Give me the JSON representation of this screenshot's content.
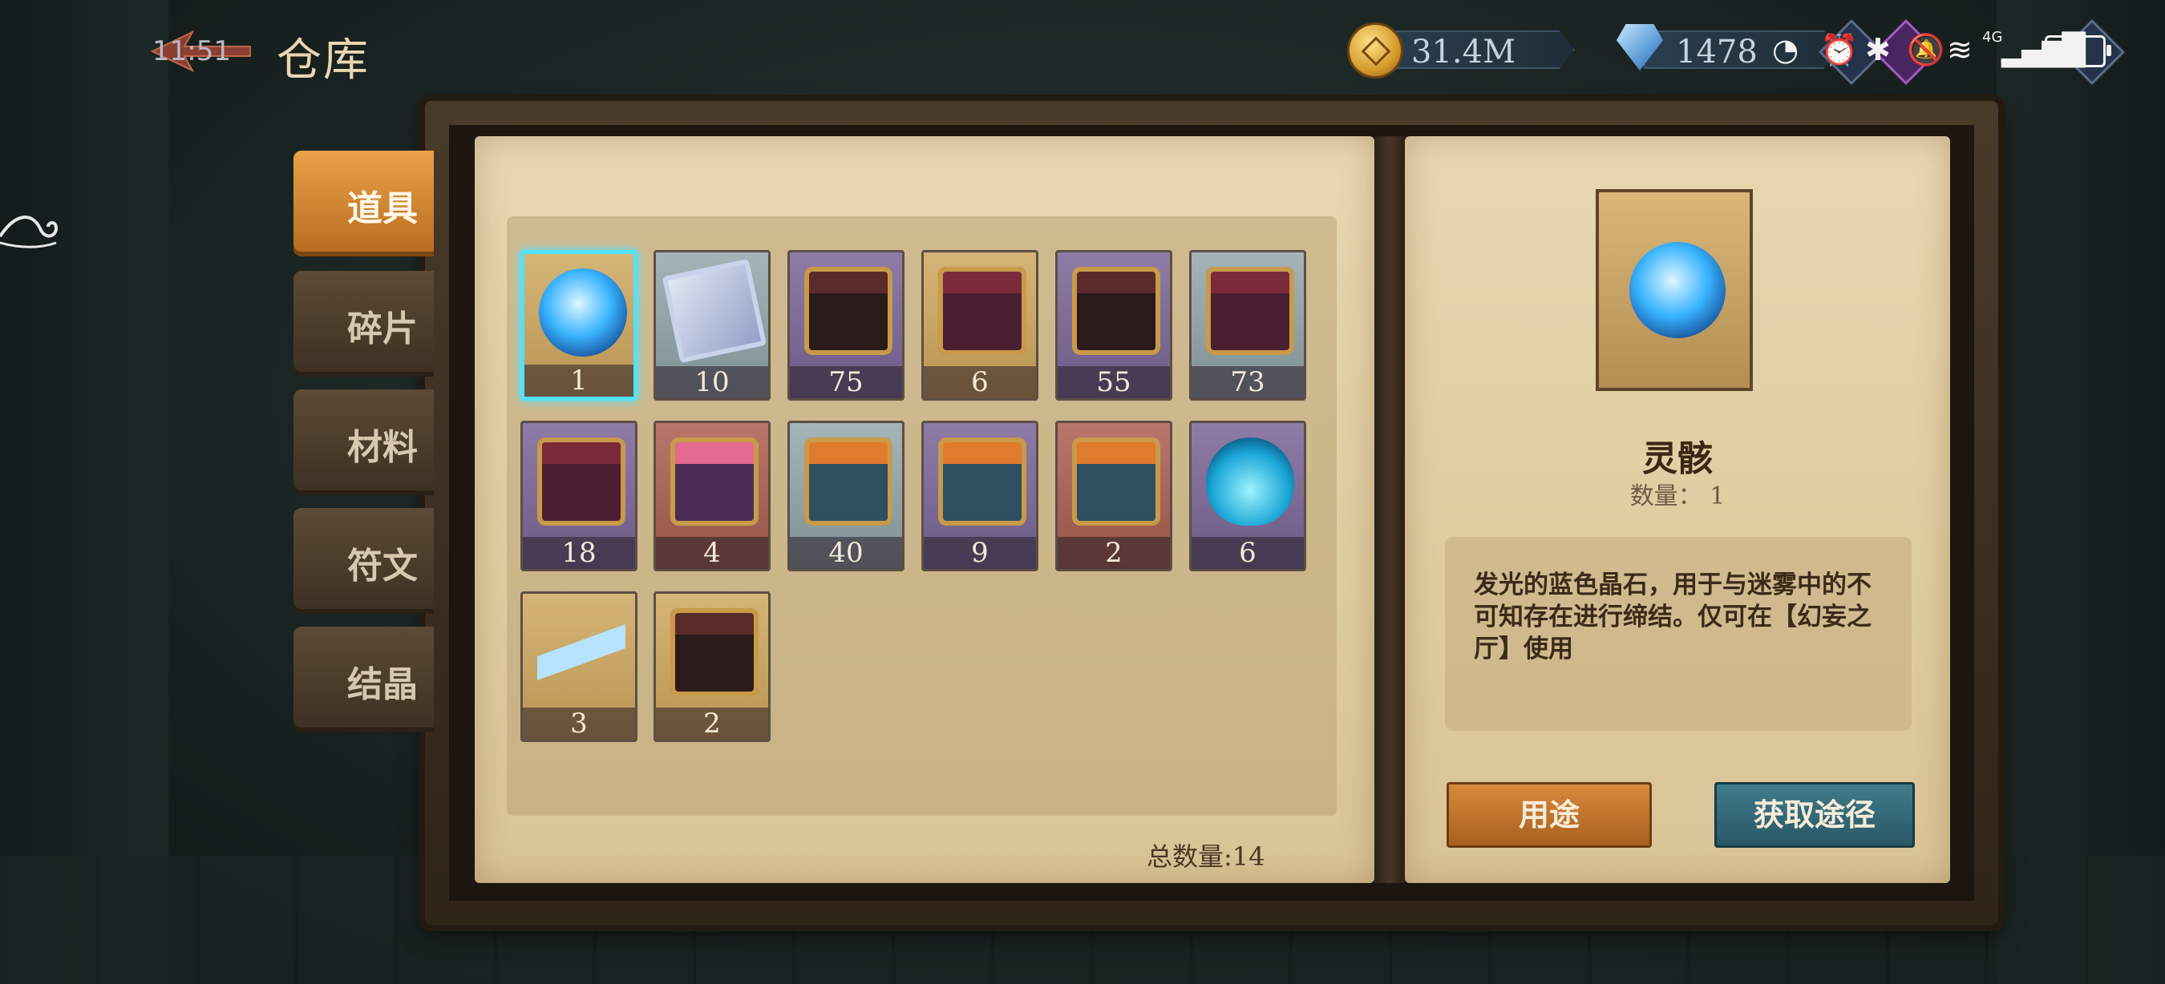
{
  "header": {
    "title": "仓库",
    "clock": "11:51",
    "gold": "31.4M",
    "gems": "1478"
  },
  "status_bar": {
    "network": "4G"
  },
  "tabs": [
    {
      "label": "道具",
      "active": true
    },
    {
      "label": "碎片",
      "active": false
    },
    {
      "label": "材料",
      "active": false
    },
    {
      "label": "符文",
      "active": false
    },
    {
      "label": "结晶",
      "active": false
    }
  ],
  "items": [
    {
      "qty": "1",
      "icon": "blue-spirit-orb-icon",
      "frame": "gold"
    },
    {
      "qty": "10",
      "icon": "silver-card-icon",
      "frame": "silver"
    },
    {
      "qty": "75",
      "icon": "dark-chest-icon",
      "frame": "purple"
    },
    {
      "qty": "6",
      "icon": "red-chest-icon",
      "frame": "gold"
    },
    {
      "qty": "55",
      "icon": "dark-chest-icon",
      "frame": "purple"
    },
    {
      "qty": "73",
      "icon": "red-gift-box-icon",
      "frame": "silver"
    },
    {
      "qty": "18",
      "icon": "red-gift-box-icon",
      "frame": "purple"
    },
    {
      "qty": "4",
      "icon": "pink-gift-box-icon",
      "frame": "red"
    },
    {
      "qty": "40",
      "icon": "orange-gift-box-icon",
      "frame": "silver"
    },
    {
      "qty": "9",
      "icon": "orange-gift-box-icon",
      "frame": "purple"
    },
    {
      "qty": "2",
      "icon": "orange-gift-box-icon",
      "frame": "red"
    },
    {
      "qty": "6",
      "icon": "blue-potion-icon",
      "frame": "purple"
    },
    {
      "qty": "3",
      "icon": "vial-icon",
      "frame": "gold"
    },
    {
      "qty": "2",
      "icon": "chained-gift-box-icon",
      "frame": "gold"
    }
  ],
  "total": "总数量:14",
  "detail": {
    "name": "灵骸",
    "qty": "数量： 1",
    "description": "发光的蓝色晶石，用于与迷雾中的不可知存在进行缔结。仅可在【幻妄之厅】使用",
    "use_button": "用途",
    "source_button": "获取途径"
  },
  "colors": {
    "accent_selected": "#4fe3ff",
    "tab_active": "#e9a24a",
    "parchment": "#e8d7b0"
  }
}
